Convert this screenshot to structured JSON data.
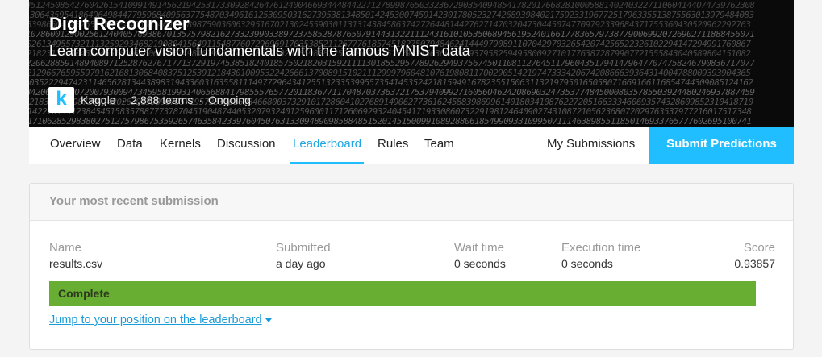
{
  "competition": {
    "title": "Digit Recognizer",
    "subtitle": "Learn computer vision fundamentals with the famous MNIST data",
    "host": "Kaggle",
    "teams": "2,888 teams",
    "status": "Ongoing",
    "logo_letter": "k",
    "banner_icon": "handwritten-digits-image",
    "logo_icon": "kaggle-logo-icon"
  },
  "tabs": [
    {
      "label": "Overview"
    },
    {
      "label": "Data"
    },
    {
      "label": "Kernels"
    },
    {
      "label": "Discussion"
    },
    {
      "label": "Leaderboard",
      "active": true
    },
    {
      "label": "Rules"
    },
    {
      "label": "Team"
    }
  ],
  "actions": {
    "my_submissions": "My Submissions",
    "submit_predictions": "Submit Predictions"
  },
  "submission": {
    "heading": "Your most recent submission",
    "columns": {
      "name": "Name",
      "submitted": "Submitted",
      "wait_time": "Wait time",
      "execution_time": "Execution time",
      "score": "Score"
    },
    "values": {
      "name": "results.csv",
      "submitted": "a day ago",
      "wait_time": "0 seconds",
      "execution_time": "0 seconds",
      "score": "0.93857"
    },
    "status": "Complete",
    "jump_link": "Jump to your position on the leaderboard"
  },
  "colors": {
    "accent": "#20beff",
    "complete": "#68ae32",
    "link": "#1a9cd8"
  }
}
